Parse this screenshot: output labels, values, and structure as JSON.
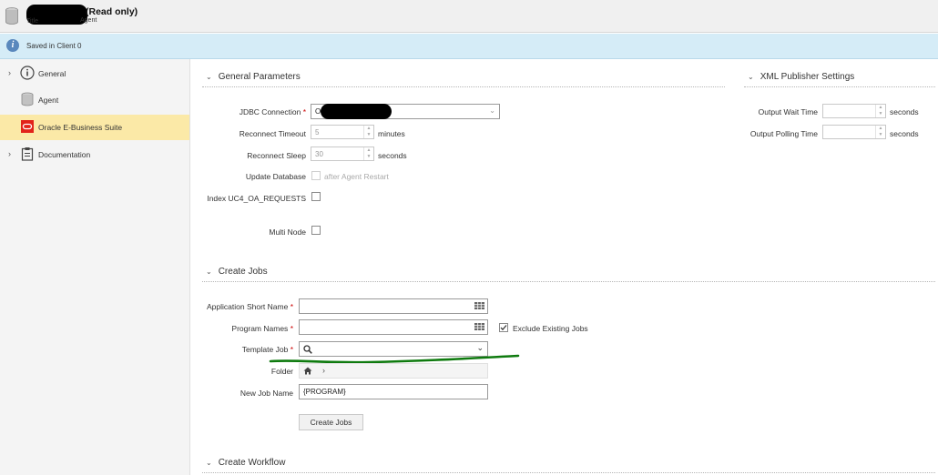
{
  "header": {
    "title": "(Read only)",
    "subtitle_left": "Title",
    "subtitle_right": "Agent",
    "icon": "database-icon"
  },
  "infobar": {
    "text": "Saved in Client 0",
    "icon": "info-icon"
  },
  "sidebar": {
    "items": [
      {
        "label": "General",
        "icon": "info-circle-icon",
        "expandable": true,
        "active": false
      },
      {
        "label": "Agent",
        "icon": "database-icon",
        "expandable": false,
        "active": false
      },
      {
        "label": "Oracle E-Business Suite",
        "icon": "oracle-icon",
        "expandable": false,
        "active": true
      },
      {
        "label": "Documentation",
        "icon": "clipboard-icon",
        "expandable": true,
        "active": false
      }
    ]
  },
  "general_parameters": {
    "title": "General Parameters",
    "jdbc_label": "JDBC Connection",
    "jdbc_value": "O",
    "reconnect_timeout_label": "Reconnect Timeout",
    "reconnect_timeout_value": "5",
    "reconnect_timeout_unit": "minutes",
    "reconnect_sleep_label": "Reconnect Sleep",
    "reconnect_sleep_value": "30",
    "reconnect_sleep_unit": "seconds",
    "update_db_label": "Update Database",
    "update_db_text": "after Agent Restart",
    "index_label": "Index UC4_OA_REQUESTS",
    "multi_node_label": "Multi Node"
  },
  "xml_publisher": {
    "title": "XML Publisher Settings",
    "output_wait_label": "Output Wait Time",
    "output_wait_unit": "seconds",
    "output_polling_label": "Output Polling Time",
    "output_polling_unit": "seconds"
  },
  "create_jobs": {
    "title": "Create Jobs",
    "app_short_name_label": "Application Short Name",
    "program_names_label": "Program Names",
    "exclude_existing_label": "Exclude Existing Jobs",
    "exclude_existing_checked": true,
    "template_job_label": "Template Job",
    "folder_label": "Folder",
    "new_job_name_label": "New Job Name",
    "new_job_name_value": "{PROGRAM}",
    "create_button": "Create Jobs"
  },
  "create_workflow": {
    "title": "Create Workflow"
  },
  "colors": {
    "active_item": "#fbe9a7",
    "infobar": "#d5ecf7",
    "required": "#cc0000",
    "annotation": "#0e7a0e",
    "oracle_red": "#e2231a"
  }
}
